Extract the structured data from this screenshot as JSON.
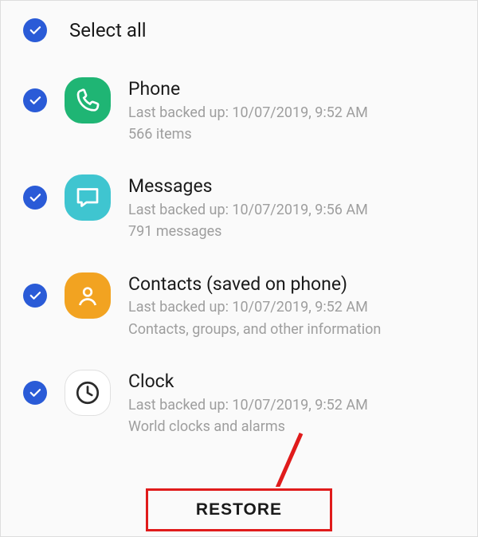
{
  "select_all": {
    "label": "Select all"
  },
  "items": [
    {
      "title": "Phone",
      "last_backup": "Last backed up: 10/07/2019, 9:52 AM",
      "detail": "566 items",
      "icon": "phone"
    },
    {
      "title": "Messages",
      "last_backup": "Last backed up: 10/07/2019, 9:56 AM",
      "detail": "791 messages",
      "icon": "messages"
    },
    {
      "title": "Contacts (saved on phone)",
      "last_backup": "Last backed up: 10/07/2019, 9:52 AM",
      "detail": "Contacts, groups, and other information",
      "icon": "contacts"
    },
    {
      "title": "Clock",
      "last_backup": "Last backed up: 10/07/2019, 9:52 AM",
      "detail": "World clocks and alarms",
      "icon": "clock"
    }
  ],
  "restore_label": "RESTORE"
}
